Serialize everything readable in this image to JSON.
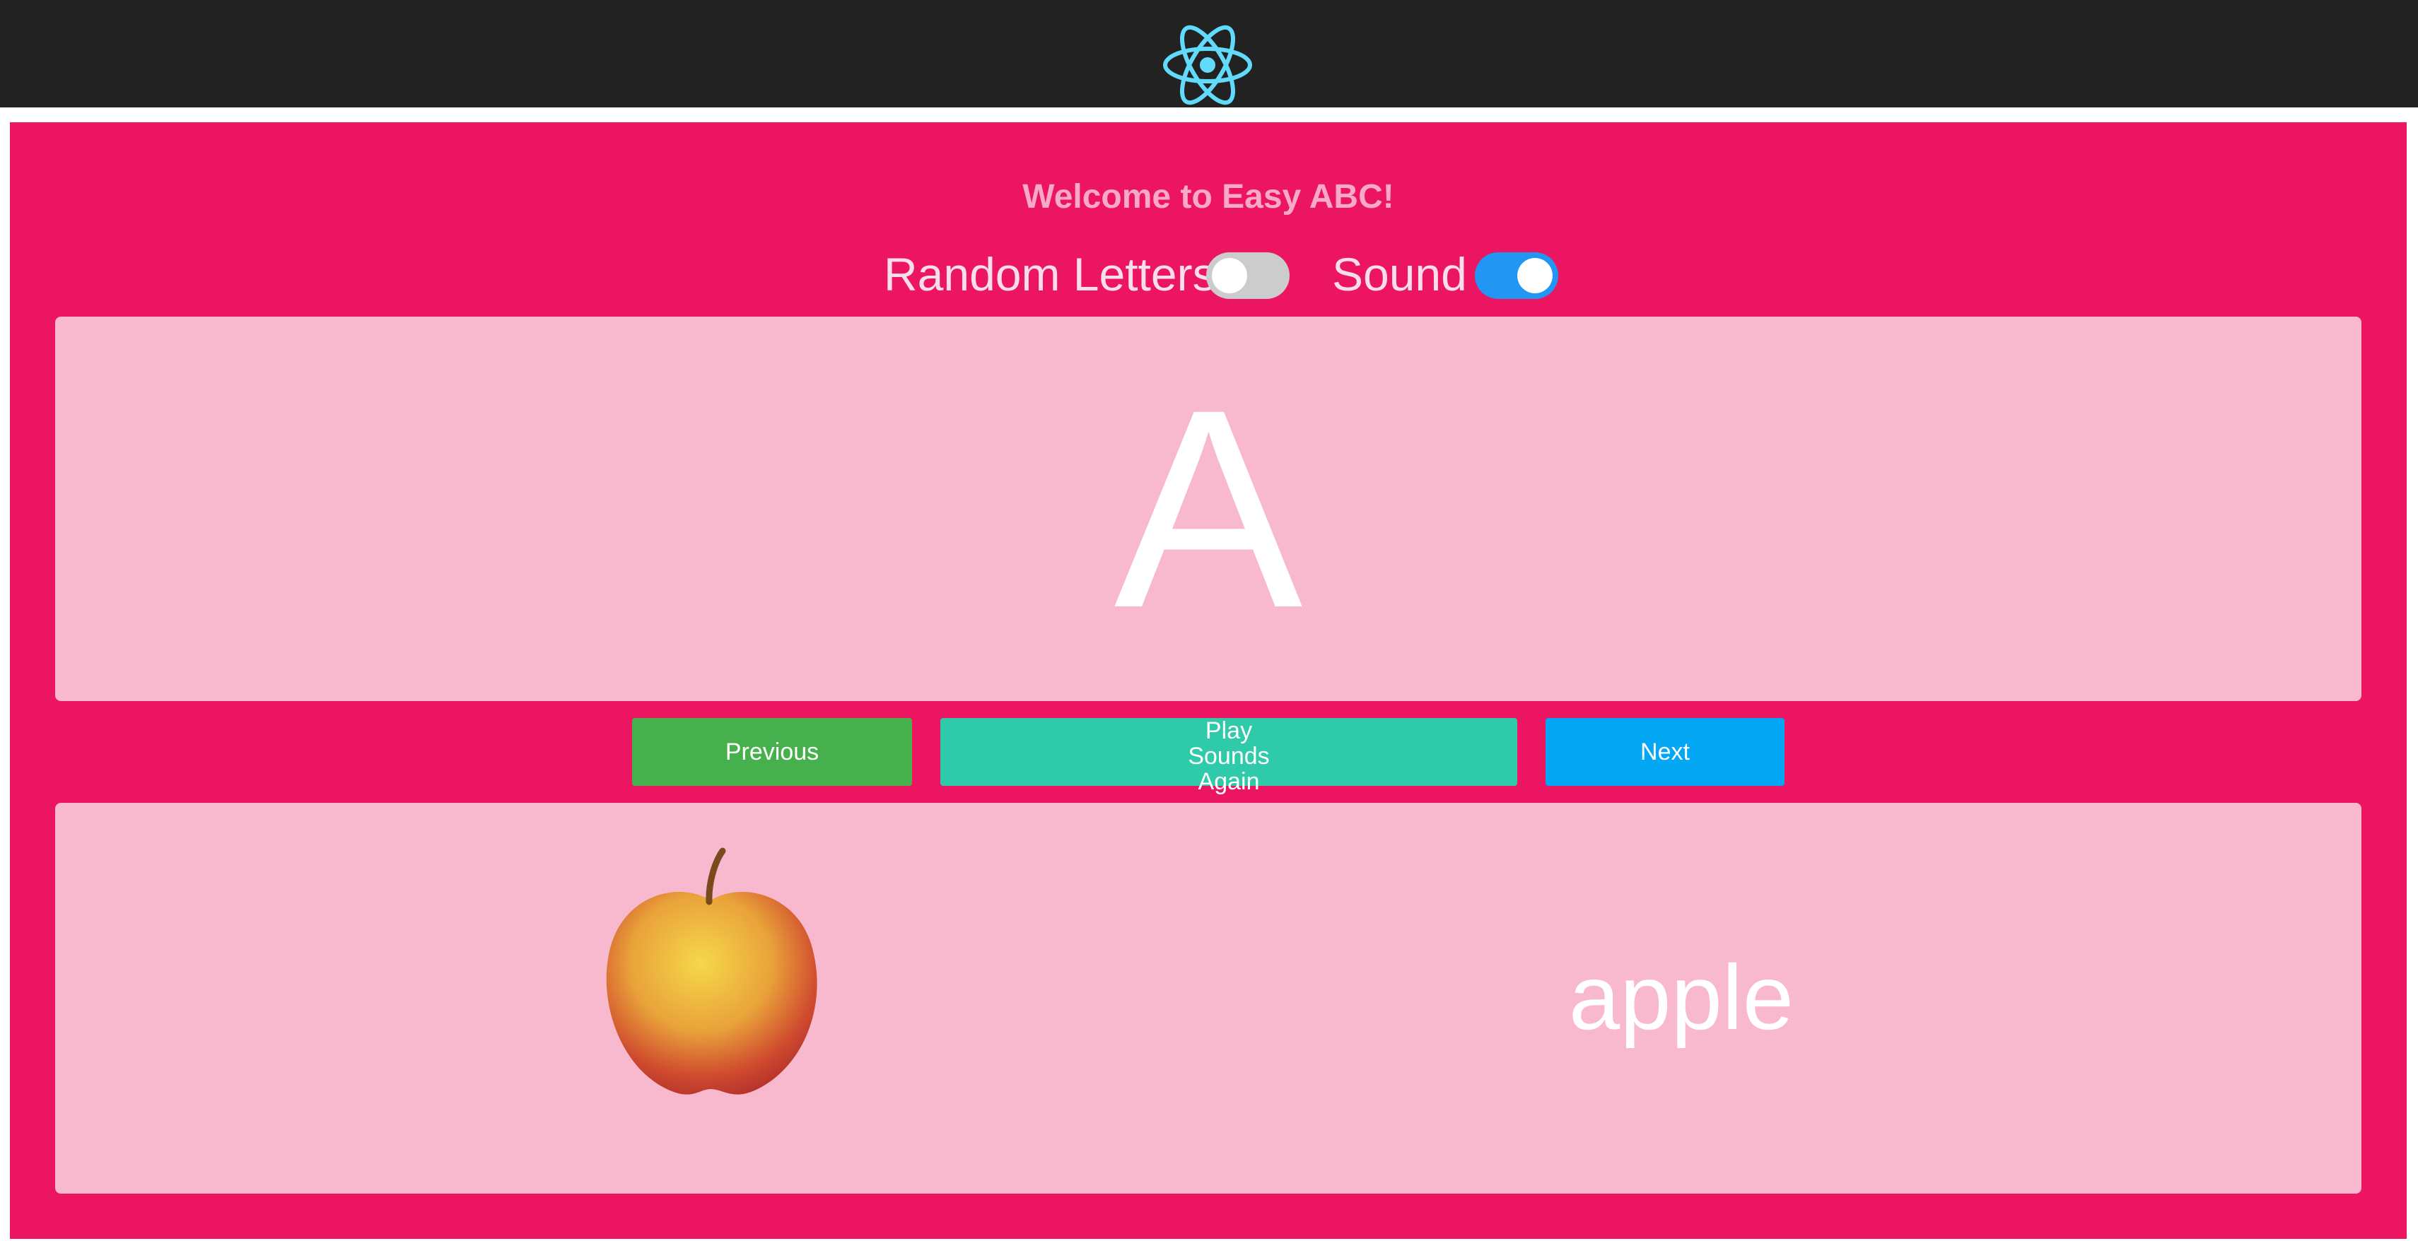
{
  "header": {
    "logo_icon": "react-atom-icon"
  },
  "app": {
    "title": "Welcome to Easy ABC!",
    "controls": {
      "random_letters_label": "Random Letters",
      "random_letters_on": false,
      "sound_label": "Sound",
      "sound_on": true
    },
    "letter": "A",
    "buttons": {
      "previous": "Previous",
      "play_again": "Play Sounds Again",
      "next": "Next"
    },
    "word": {
      "image_icon": "apple-icon",
      "text": "apple"
    }
  },
  "colors": {
    "header_bg": "#222222",
    "app_bg": "#ec1561",
    "card_bg": "#f8b8cd",
    "previous_button": "#46b04d",
    "play_button": "#2ecaaa",
    "next_button": "#03a7f3",
    "toggle_on": "#2196f3",
    "toggle_off": "#cccccc",
    "react_logo": "#61dafb"
  }
}
